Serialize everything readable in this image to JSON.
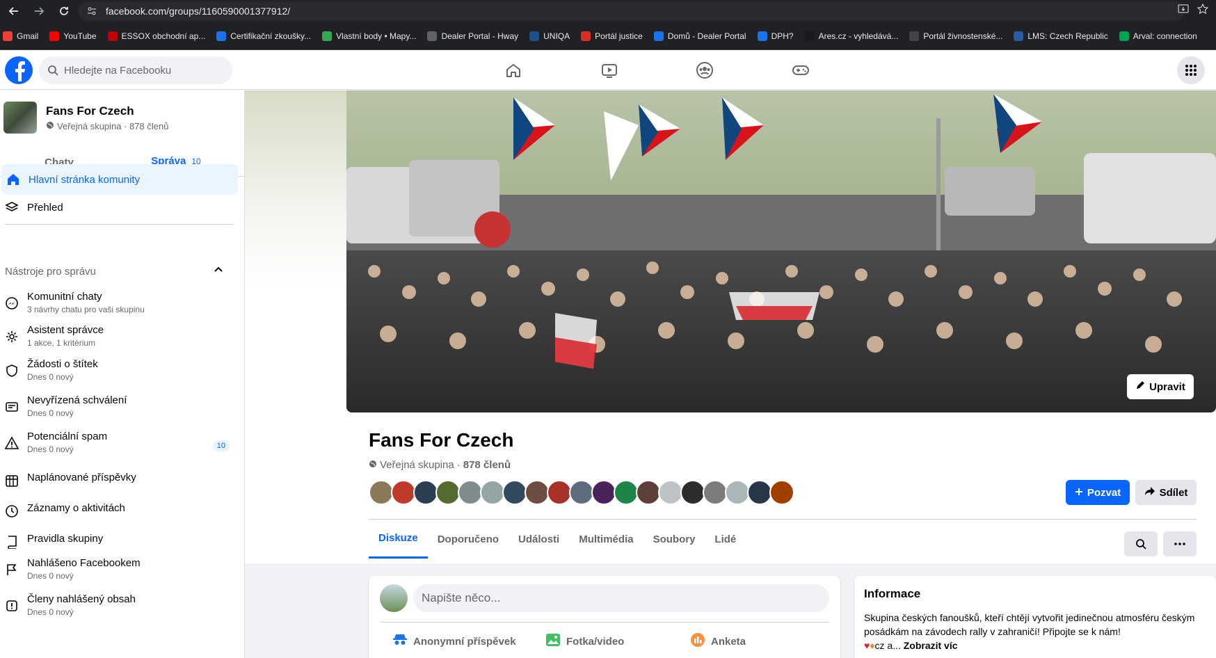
{
  "browser": {
    "url": "facebook.com/groups/1160590001377912/",
    "bookmarks": [
      {
        "label": "Gmail",
        "color": "#ea4335"
      },
      {
        "label": "YouTube",
        "color": "#ff0000"
      },
      {
        "label": "ESSOX obchodní ap...",
        "color": "#c00000"
      },
      {
        "label": "Certifikační zkoušky...",
        "color": "#1a73e8"
      },
      {
        "label": "Vlastní body • Mapy...",
        "color": "#34a853"
      },
      {
        "label": "Dealer Portal - Hway",
        "color": "#5f6368"
      },
      {
        "label": "UNIQA",
        "color": "#1f4e8c"
      },
      {
        "label": "Portál justice",
        "color": "#d93025"
      },
      {
        "label": "Domů - Dealer Portal",
        "color": "#1a73e8"
      },
      {
        "label": "DPH?",
        "color": "#1a73e8"
      },
      {
        "label": "Ares.cz - vyhledává...",
        "color": "#1a1a1a"
      },
      {
        "label": "Portál živnostenské...",
        "color": "#444444"
      },
      {
        "label": "LMS: Czech Republic",
        "color": "#2c5aa0"
      },
      {
        "label": "Arval: connection",
        "color": "#00a34f"
      }
    ]
  },
  "topbar": {
    "search_placeholder": "Hledejte na Facebooku"
  },
  "sidebar": {
    "group_name": "Fans For Czech",
    "group_sub": "Veřejná skupina · 878 členů",
    "tab_chats": "Chaty",
    "tab_admin": "Správa",
    "tab_admin_count": "10",
    "home": "Hlavní stránka komunity",
    "overview": "Přehled",
    "tools_title": "Nástroje pro správu",
    "tools": [
      {
        "title": "Komunitní chaty",
        "sub": "3 návrhy chatu pro vaši skupinu"
      },
      {
        "title": "Asistent správce",
        "sub": "1 akce, 1 kritérium"
      },
      {
        "title": "Žádosti o štítek",
        "sub": "Dnes 0 nový"
      },
      {
        "title": "Nevyřízená schválení",
        "sub": "Dnes 0 nový"
      },
      {
        "title": "Potenciální spam",
        "sub": "Dnes 0 nový",
        "badge": "10"
      },
      {
        "title": "Naplánované příspěvky",
        "sub": ""
      },
      {
        "title": "Záznamy o aktivitách",
        "sub": ""
      },
      {
        "title": "Pravidla skupiny",
        "sub": ""
      },
      {
        "title": "Nahlášeno Facebookem",
        "sub": "Dnes 0 nový"
      },
      {
        "title": "Členy nahlášený obsah",
        "sub": "Dnes 0 nový"
      }
    ]
  },
  "main": {
    "edit_cover": "Upravit",
    "group_name": "Fans For Czech",
    "group_privacy": "Veřejná skupina",
    "group_members": "878 členů",
    "invite": "Pozvat",
    "share": "Sdílet",
    "tabs": [
      "Diskuze",
      "Doporučeno",
      "Události",
      "Multimédia",
      "Soubory",
      "Lidé"
    ],
    "composer_placeholder": "Napište něco...",
    "composer_actions": [
      "Anonymní příspěvek",
      "Fotka/video",
      "Anketa"
    ],
    "info_title": "Informace",
    "info_text": "Skupina českých fanoušků, kteří chtějí vytvořit jedinečnou atmosféru českým posádkám na závodech rally v zahraničí! Připojte se k nám!",
    "info_tail": "cz a...",
    "info_more": "Zobrazit víc"
  },
  "colors": {
    "accent": "#0866ff",
    "active_bg": "#ebf5ff"
  }
}
